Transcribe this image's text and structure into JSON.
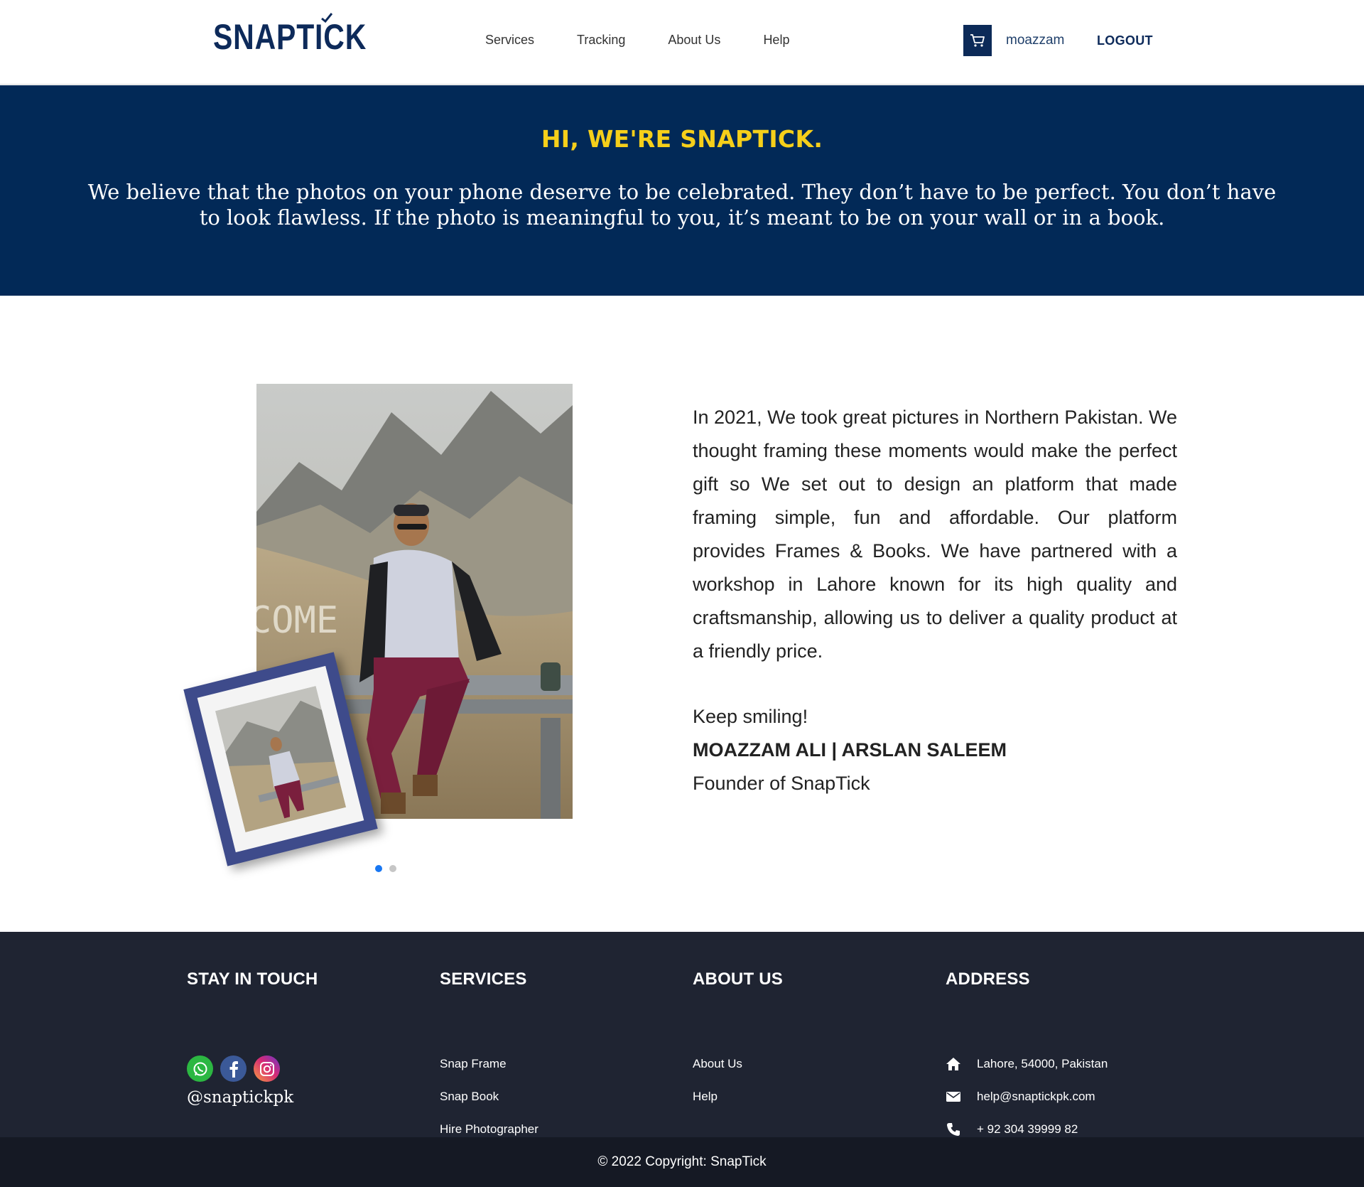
{
  "header": {
    "logo": "SNAPTICK",
    "nav": [
      "Services",
      "Tracking",
      "About Us",
      "Help"
    ],
    "username": "moazzam",
    "logout": "LOGOUT",
    "cart_icon": "cart-icon"
  },
  "hero": {
    "title": "HI, WE'RE SNAPTICK.",
    "text": "We believe that the photos on your phone deserve to be celebrated. They don’t have to be perfect. You don’t have to look flawless. If the photo is meaningful to you, it’s meant to be on your wall or in a book."
  },
  "about": {
    "story": "In 2021, We took great pictures in Northern Pakistan. We thought framing these moments would make the perfect gift so We set out to design an platform that made framing simple, fun and affordable. Our platform provides Frames & Books. We have partnered with a workshop in Lahore known for its high quality and craftsmanship, allowing us to deliver a quality product at a friendly price.",
    "sign_greeting": "Keep smiling!",
    "sign_names": "MOAZZAM ALI | ARSLAN SALEEM",
    "sign_title": "Founder of SnapTick",
    "photo_rock_text": "COME",
    "carousel": {
      "slides": 2,
      "active": 1
    }
  },
  "footer": {
    "stay_in_touch": {
      "title": "STAY IN TOUCH",
      "handle": "@snaptickpk",
      "icons": [
        "whatsapp-icon",
        "facebook-icon",
        "instagram-icon"
      ]
    },
    "services": {
      "title": "SERVICES",
      "links": [
        "Snap Frame",
        "Snap Book",
        "Hire Photographer"
      ]
    },
    "about": {
      "title": "ABOUT US",
      "links": [
        "About Us",
        "Help"
      ]
    },
    "address": {
      "title": "ADDRESS",
      "items": [
        {
          "icon": "home-icon",
          "text": "Lahore, 54000, Pakistan"
        },
        {
          "icon": "envelope-icon",
          "text": "help@snaptickpk.com"
        },
        {
          "icon": "phone-icon",
          "text": "+ 92 304 39999 82"
        }
      ]
    },
    "copyright": "© 2022 Copyright: SnapTick"
  },
  "colors": {
    "navy": "#022957",
    "yellow": "#f6cf1a",
    "footer": "#1f2432",
    "footer_bottom": "#151924",
    "frame": "#3e4b8b"
  }
}
